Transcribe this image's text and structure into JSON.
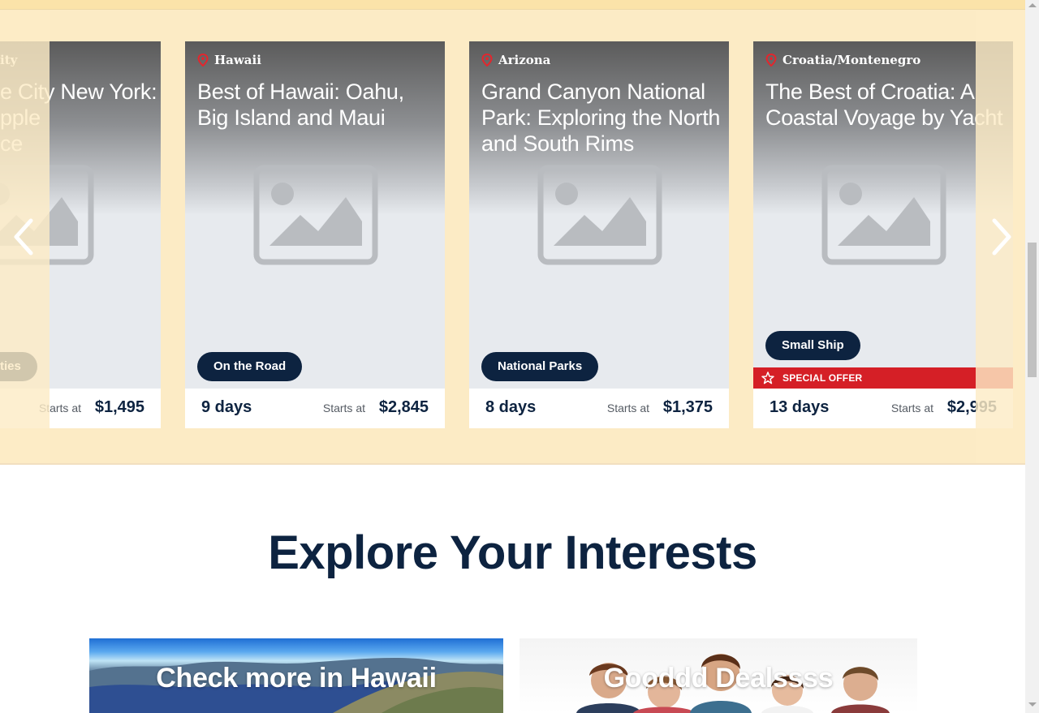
{
  "carousel": {
    "prev_label": "‹",
    "next_label": "›",
    "cards": [
      {
        "location": "New York City",
        "location_visible": "ity",
        "title_visible_lines": [
          "e City New York:",
          "pple",
          "ce"
        ],
        "tag_visible": "ties",
        "days": "",
        "starts_label": "Starts at",
        "price": "$1,495"
      },
      {
        "location": "Hawaii",
        "title": "Best of Hawaii: Oahu, Big Island and Maui",
        "tag": "On the Road",
        "days": "9 days",
        "starts_label": "Starts at",
        "price": "$2,845"
      },
      {
        "location": "Arizona",
        "title": "Grand Canyon National Park: Exploring the North and South Rims",
        "tag": "National Parks",
        "days": "8 days",
        "starts_label": "Starts at",
        "price": "$1,375"
      },
      {
        "location": "Croatia/Montenegro",
        "title": "The Best of Croatia: A Coastal Voyage by Yacht",
        "tag": "Small Ship",
        "offer": "SPECIAL OFFER",
        "days": "13 days",
        "starts_label": "Starts at",
        "price": "$2,995"
      }
    ]
  },
  "interests": {
    "title": "Explore Your Interests",
    "tiles": [
      {
        "label": "Check more in Hawaii"
      },
      {
        "label": "Gooddd Dealssss"
      }
    ]
  },
  "colors": {
    "navy": "#0d2340",
    "accent_red": "#d51f26",
    "band": "#fcebc5"
  },
  "icons": [
    "map-pin-icon",
    "image-placeholder-icon",
    "star-outline-icon",
    "chevron-left-icon",
    "chevron-right-icon"
  ]
}
